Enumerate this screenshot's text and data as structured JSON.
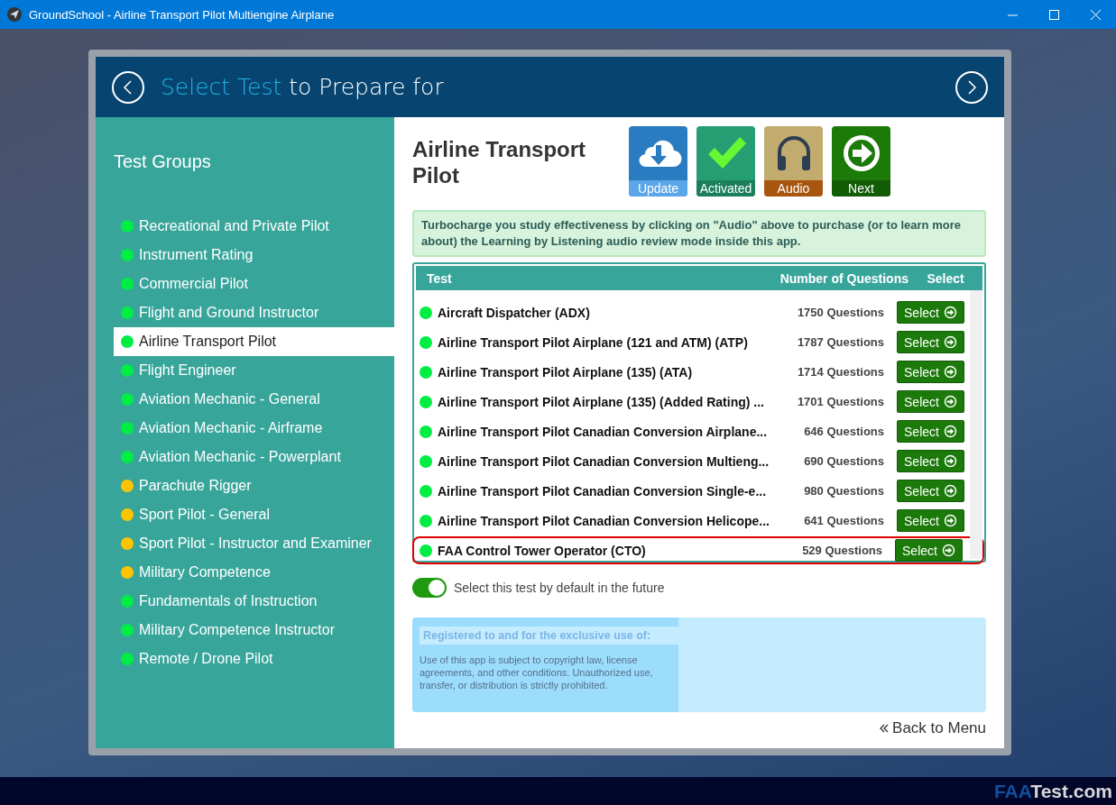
{
  "window": {
    "title": "GroundSchool  - Airline Transport Pilot Multiengine Airplane"
  },
  "header": {
    "title_highlight": "Select Test",
    "title_rest": "to Prepare for"
  },
  "sidebar": {
    "heading": "Test Groups",
    "items": [
      {
        "label": "Recreational and Private Pilot",
        "color": "#00ee44",
        "selected": false
      },
      {
        "label": "Instrument Rating",
        "color": "#00ee44",
        "selected": false
      },
      {
        "label": "Commercial Pilot",
        "color": "#00ee44",
        "selected": false
      },
      {
        "label": "Flight and Ground Instructor",
        "color": "#00ee44",
        "selected": false
      },
      {
        "label": "Airline Transport Pilot",
        "color": "#00ee44",
        "selected": true
      },
      {
        "label": "Flight Engineer",
        "color": "#00ee44",
        "selected": false
      },
      {
        "label": "Aviation Mechanic - General",
        "color": "#00ee44",
        "selected": false
      },
      {
        "label": "Aviation Mechanic - Airframe",
        "color": "#00ee44",
        "selected": false
      },
      {
        "label": "Aviation Mechanic - Powerplant",
        "color": "#00ee44",
        "selected": false
      },
      {
        "label": "Parachute Rigger",
        "color": "#ffc400",
        "selected": false
      },
      {
        "label": "Sport Pilot - General",
        "color": "#ffc400",
        "selected": false
      },
      {
        "label": "Sport Pilot - Instructor and Examiner",
        "color": "#ffc400",
        "selected": false
      },
      {
        "label": "Military Competence",
        "color": "#ffc400",
        "selected": false
      },
      {
        "label": "Fundamentals of Instruction",
        "color": "#00ee44",
        "selected": false
      },
      {
        "label": "Military Competence Instructor",
        "color": "#00ee44",
        "selected": false
      },
      {
        "label": "Remote / Drone Pilot",
        "color": "#00ee44",
        "selected": false
      }
    ]
  },
  "group_title": "Airline Transport Pilot",
  "actions": [
    {
      "kind": "update",
      "label": "Update"
    },
    {
      "kind": "activated",
      "label": "Activated"
    },
    {
      "kind": "audio",
      "label": "Audio"
    },
    {
      "kind": "next",
      "label": "Next"
    }
  ],
  "notice": "Turbocharge you study effectiveness by clicking on \"Audio\" above to purchase (or to learn more about) the Learning by Listening audio review mode inside this app.",
  "table": {
    "columns": [
      "Test",
      "Number of Questions",
      "Select"
    ],
    "rows": [
      {
        "name": "Aircraft Dispatcher (ADX)",
        "count": "1750 Questions",
        "button": "Select",
        "highlighted": false
      },
      {
        "name": "Airline Transport Pilot Airplane (121 and ATM) (ATP)",
        "count": "1787 Questions",
        "button": "Select",
        "highlighted": false
      },
      {
        "name": "Airline Transport Pilot Airplane (135) (ATA)",
        "count": "1714 Questions",
        "button": "Select",
        "highlighted": false
      },
      {
        "name": "Airline Transport Pilot Airplane (135) (Added Rating) ...",
        "count": "1701 Questions",
        "button": "Select",
        "highlighted": false
      },
      {
        "name": "Airline Transport Pilot Canadian Conversion Airplane...",
        "count": "646 Questions",
        "button": "Select",
        "highlighted": false
      },
      {
        "name": "Airline Transport Pilot Canadian Conversion Multieng...",
        "count": "690 Questions",
        "button": "Select",
        "highlighted": false
      },
      {
        "name": "Airline Transport Pilot Canadian Conversion Single-e...",
        "count": "980 Questions",
        "button": "Select",
        "highlighted": false
      },
      {
        "name": "Airline Transport Pilot Canadian Conversion Helicope...",
        "count": "641 Questions",
        "button": "Select",
        "highlighted": false
      },
      {
        "name": "FAA Control Tower Operator (CTO)",
        "count": "529 Questions",
        "button": "Select",
        "highlighted": true
      }
    ]
  },
  "default_toggle": {
    "label": "Select this test by default in the future",
    "on": true
  },
  "registration": {
    "heading": "Registered to and for the exclusive use of:",
    "text": "Use of this app is subject to copyright law, license agreements, and other conditions. Unauthorized use, transfer, or distribution is strictly prohibited."
  },
  "back_link": "Back to Menu",
  "brand": {
    "part1": "FAA",
    "part2": "Test.com"
  }
}
